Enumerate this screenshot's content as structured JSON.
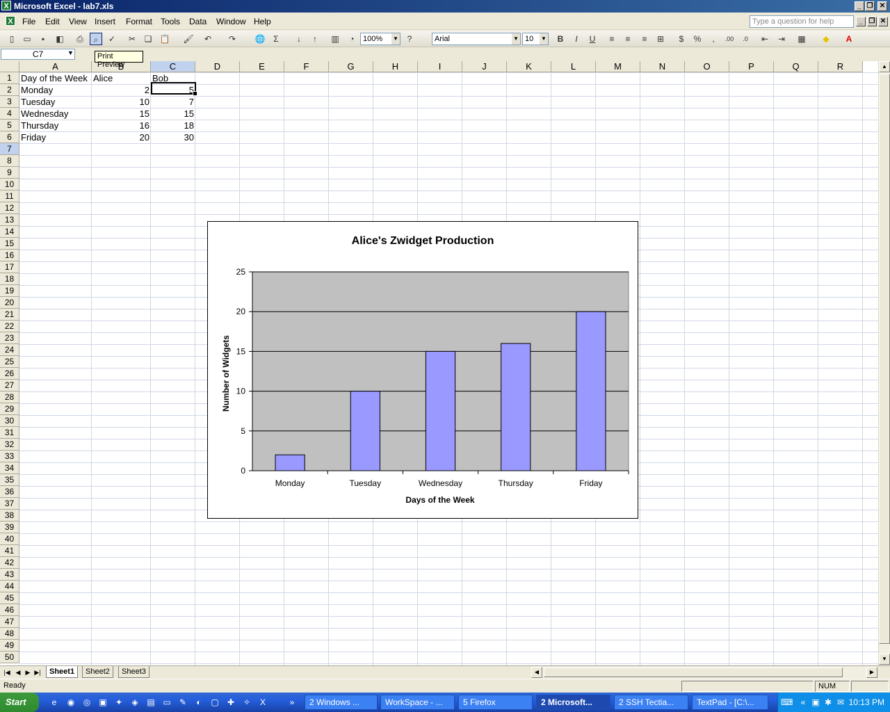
{
  "window": {
    "title": "Microsoft Excel - lab7.xls"
  },
  "menu": [
    "File",
    "Edit",
    "View",
    "Insert",
    "Format",
    "Tools",
    "Data",
    "Window",
    "Help"
  ],
  "help_placeholder": "Type a question for help",
  "toolbar": {
    "zoom": "100%",
    "font": "Arial",
    "font_size": "10",
    "tooltip": "Print Preview"
  },
  "namebox": "C7",
  "columns": [
    "A",
    "B",
    "C",
    "D",
    "E",
    "F",
    "G",
    "H",
    "I",
    "J",
    "K",
    "L",
    "M",
    "N",
    "O",
    "P",
    "Q",
    "R"
  ],
  "rows": [
    "1",
    "2",
    "3",
    "4",
    "5",
    "6",
    "7",
    "8",
    "9",
    "10",
    "11",
    "12",
    "13",
    "14",
    "15",
    "16",
    "17",
    "18",
    "19",
    "20",
    "21",
    "22",
    "23",
    "24",
    "25",
    "26",
    "27",
    "28",
    "29",
    "30",
    "31",
    "32",
    "33",
    "34",
    "35",
    "36",
    "37",
    "38",
    "39",
    "40",
    "41",
    "42",
    "43",
    "44",
    "45",
    "46",
    "47",
    "48",
    "49",
    "50"
  ],
  "sheet": {
    "header": [
      "Day of the Week",
      "Alice",
      "Bob"
    ],
    "data": [
      [
        "Monday",
        "2",
        "5"
      ],
      [
        "Tuesday",
        "10",
        "7"
      ],
      [
        "Wednesday",
        "15",
        "15"
      ],
      [
        "Thursday",
        "16",
        "18"
      ],
      [
        "Friday",
        "20",
        "30"
      ]
    ]
  },
  "chart_data": {
    "type": "bar",
    "title": "Alice's Zwidget Production",
    "xlabel": "Days of the Week",
    "ylabel": "Number of Widgets",
    "categories": [
      "Monday",
      "Tuesday",
      "Wednesday",
      "Thursday",
      "Friday"
    ],
    "values": [
      2,
      10,
      15,
      16,
      20
    ],
    "ylim": [
      0,
      25
    ],
    "yticks": [
      "0",
      "5",
      "10",
      "15",
      "20",
      "25"
    ],
    "grid": true,
    "legend": "none",
    "bar_color": "#9999ff",
    "plot_bg": "#c0c0c0"
  },
  "sheet_tabs": [
    "Sheet1",
    "Sheet2",
    "Sheet3"
  ],
  "status": {
    "left": "Ready",
    "num": "NUM"
  },
  "taskbar": {
    "start": "Start",
    "tasks": [
      "2 Windows ...",
      "WorkSpace - ...",
      "5 Firefox",
      "2 Microsoft...",
      "2 SSH Tectia...",
      "TextPad - [C:\\..."
    ],
    "clock": "10:13 PM"
  }
}
